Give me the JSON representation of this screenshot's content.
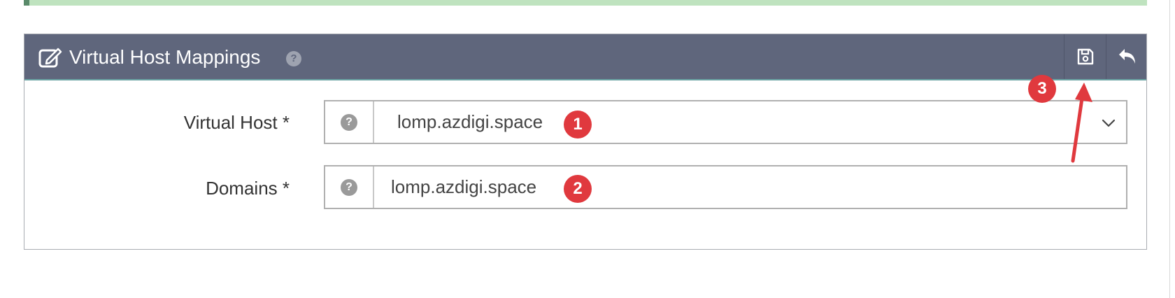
{
  "panel": {
    "title": "Virtual Host Mappings",
    "help_glyph": "?",
    "header_actions": [
      {
        "name": "save",
        "icon": "floppy-disk-icon"
      },
      {
        "name": "back",
        "icon": "undo-arrow-icon"
      }
    ]
  },
  "form": {
    "virtual_host": {
      "label": "Virtual Host *",
      "help_glyph": "?",
      "selected_value": "lomp.azdigi.space"
    },
    "domains": {
      "label": "Domains *",
      "help_glyph": "?",
      "value": "lomp.azdigi.space"
    }
  },
  "annotations": {
    "badge_1": "1",
    "badge_2": "2",
    "badge_3": "3"
  },
  "colors": {
    "header_bg": "#5f667c",
    "badge_red": "#e0393e",
    "success_strip": "#bfe3bf"
  }
}
